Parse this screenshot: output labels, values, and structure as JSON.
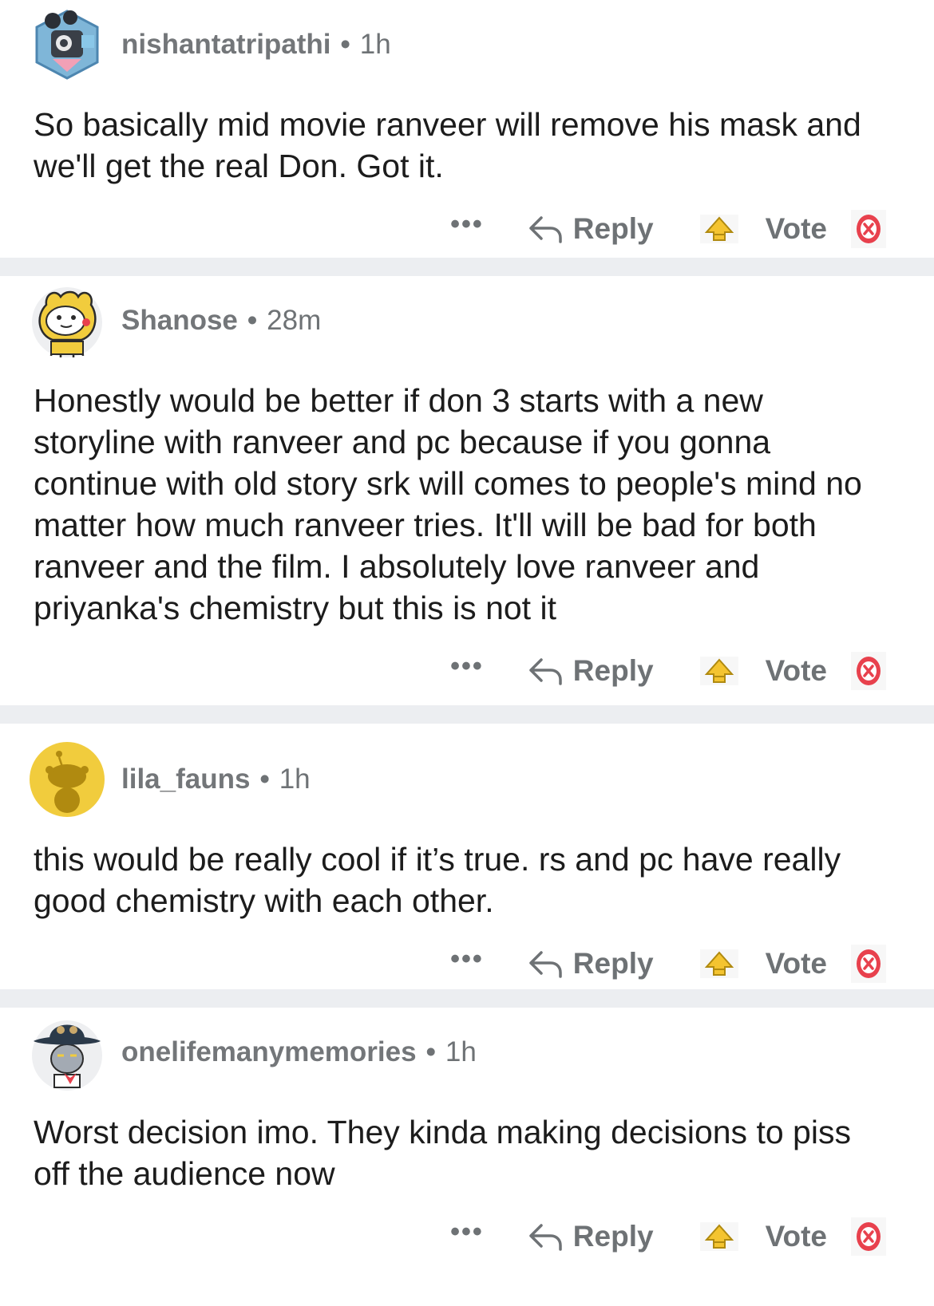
{
  "comments": [
    {
      "username": "nishantatripathi",
      "age": "1h",
      "text": "So basically mid movie ranveer will remove his mask and we'll get the real Don. Got it.",
      "avatar": "camera-robot-avatar",
      "more_label": "•••",
      "reply_label": "Reply",
      "vote_label": "Vote"
    },
    {
      "username": "Shanose",
      "age": "28m",
      "text": "Honestly would be better if don 3 starts with a new storyline with ranveer and pc because if you gonna continue with old story srk will comes to people's mind no matter how much ranveer tries. It'll will be bad for both ranveer and the film. I absolutely love ranveer and priyanka's chemistry but this is not it",
      "avatar": "tiger-costume-avatar",
      "more_label": "•••",
      "reply_label": "Reply",
      "vote_label": "Vote"
    },
    {
      "username": "lila_fauns",
      "age": "1h",
      "text": "this would be really cool if it’s true. rs and pc have really good chemistry with each other.",
      "avatar": "default-snoo-avatar",
      "more_label": "•••",
      "reply_label": "Reply",
      "vote_label": "Vote"
    },
    {
      "username": "onelifemanymemories",
      "age": "1h",
      "text": "Worst decision imo. They kinda making decisions to piss off the audience now",
      "avatar": "cowboy-snoo-avatar",
      "more_label": "•••",
      "reply_label": "Reply",
      "vote_label": "Vote"
    }
  ],
  "colors": {
    "separator": "#eceef1",
    "meta_text": "#6e7275",
    "body_text": "#1c1c1c",
    "upvote_icon": "#f4c430",
    "downvote_icon": "#e8414d",
    "avatar_yellow": "#f1cc3d"
  }
}
